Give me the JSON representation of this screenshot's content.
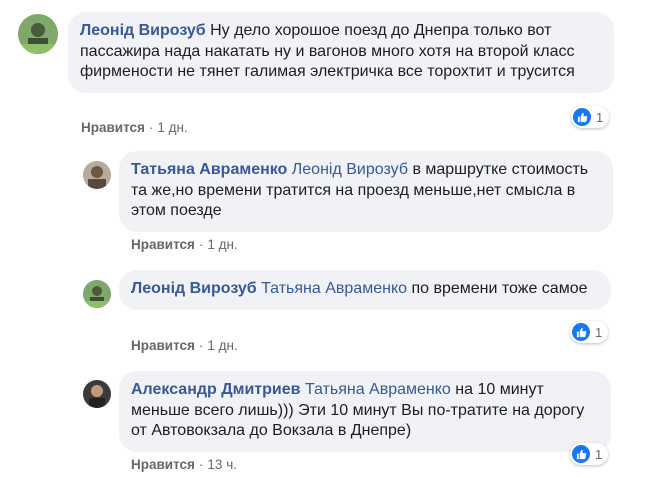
{
  "comments": [
    {
      "author": "Леонід Вирозуб",
      "mention": "",
      "text": "Ну дело хорошое поезд до Днепра только вот пассажира нада накатать ну и вагонов много хотя на второй класс фирмености не тянет галимая электричка все торохтит и трусится",
      "like_label": "Нравится",
      "separator": "·",
      "time": "1 дн.",
      "reaction_count": "1",
      "reaction_icon": "like-thumb-icon"
    },
    {
      "author": "Татьяна Авраменко",
      "mention": "Леонід Вирозуб",
      "text": "в маршрутке стоимость та же,но времени тратится на проезд меньше,нет смысла в этом поезде",
      "like_label": "Нравится",
      "separator": "·",
      "time": "1 дн."
    },
    {
      "author": "Леонід Вирозуб",
      "mention": "Татьяна Авраменко",
      "text": "по времени тоже самое",
      "like_label": "Нравится",
      "separator": "·",
      "time": "1 дн.",
      "reaction_count": "1",
      "reaction_icon": "like-thumb-icon"
    },
    {
      "author": "Александр Дмитриев",
      "mention": "Татьяна Авраменко",
      "text": "на 10 минут меньше всего лишь))) Эти 10 минут Вы по-тратите на дорогу от Автовокзала до Вокзала в Днепре)",
      "like_label": "Нравится",
      "separator": "·",
      "time": "13 ч.",
      "reaction_count": "1",
      "reaction_icon": "like-thumb-icon"
    }
  ],
  "colors": {
    "bubble": "#f0f2f5",
    "author": "#385898",
    "meta": "#65676b",
    "like_blue": "#1877f2"
  }
}
